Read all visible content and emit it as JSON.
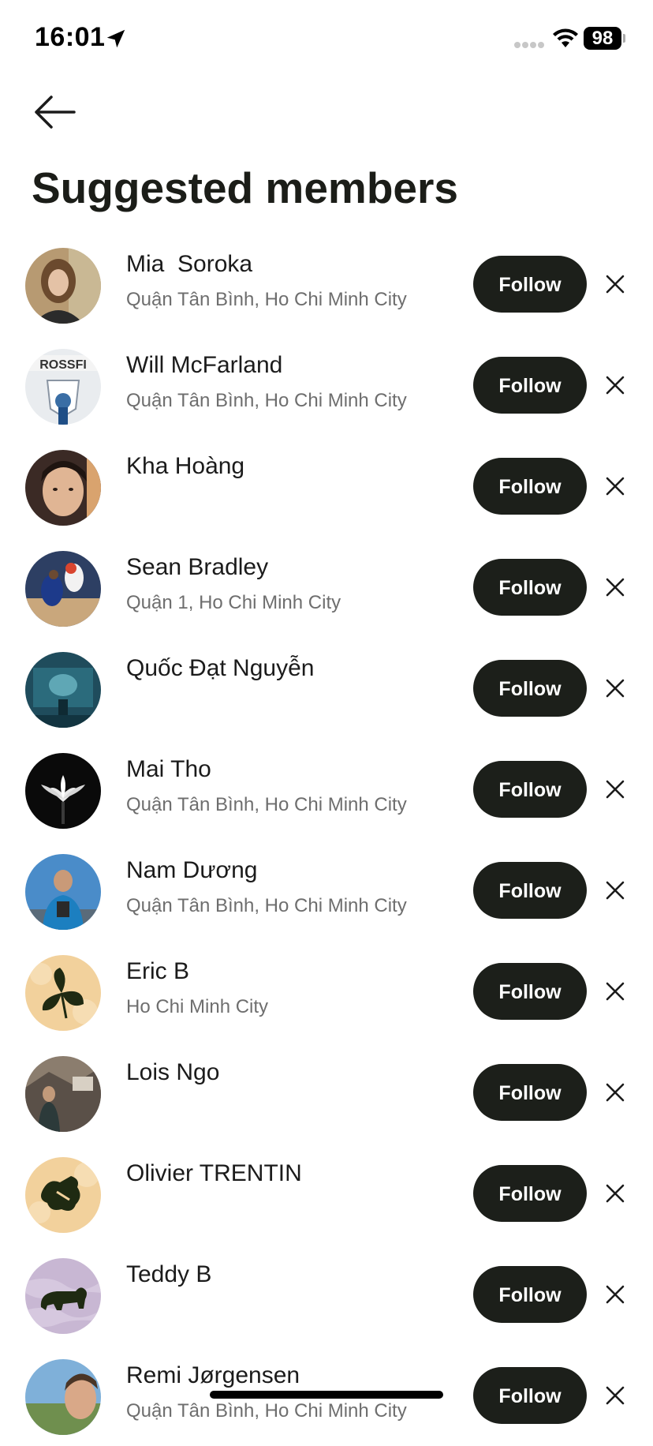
{
  "status_bar": {
    "time": "16:01",
    "battery": "98"
  },
  "header": {
    "title": "Suggested members"
  },
  "follow_label": "Follow",
  "members": [
    {
      "name": "Mia  Soroka",
      "location": "Quận Tân Bình, Ho Chi Minh City"
    },
    {
      "name": "Will McFarland",
      "location": "Quận Tân Bình, Ho Chi Minh City"
    },
    {
      "name": "Kha Hoàng",
      "location": ""
    },
    {
      "name": "Sean Bradley",
      "location": "Quận 1, Ho Chi Minh City"
    },
    {
      "name": "Quốc Đạt Nguyễn",
      "location": ""
    },
    {
      "name": "Mai Tho",
      "location": "Quận Tân Bình, Ho Chi Minh City"
    },
    {
      "name": "Nam Dương",
      "location": "Quận Tân Bình, Ho Chi Minh City"
    },
    {
      "name": "Eric B",
      "location": "Ho Chi Minh City"
    },
    {
      "name": "Lois Ngo",
      "location": ""
    },
    {
      "name": "Olivier TRENTIN",
      "location": ""
    },
    {
      "name": "Teddy B",
      "location": ""
    },
    {
      "name": "Remi Jørgensen",
      "location": "Quận Tân Bình, Ho Chi Minh City"
    }
  ],
  "colors": {
    "follow_button": "#1c1f1a",
    "location_text": "#6e6e6e",
    "default_avatar_bg": "#f2d19c",
    "teddy_avatar_bg": "#c8b7d3"
  }
}
